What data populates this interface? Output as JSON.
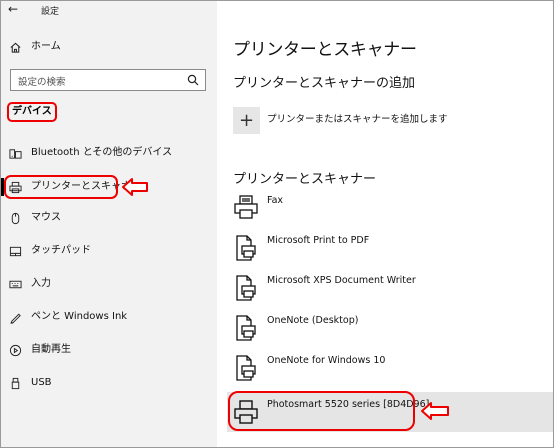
{
  "window": {
    "title": "設定",
    "back_glyph": "←"
  },
  "sidebar": {
    "home_label": "ホーム",
    "search": {
      "placeholder": "設定の検索"
    },
    "category": "デバイス",
    "items": [
      {
        "label": "Bluetooth とその他のデバイス",
        "icon": "keyboard-devices-icon"
      },
      {
        "label": "プリンターとスキャナー",
        "icon": "printer-icon",
        "selected": true
      },
      {
        "label": "マウス",
        "icon": "mouse-icon"
      },
      {
        "label": "タッチパッド",
        "icon": "touchpad-icon"
      },
      {
        "label": "入力",
        "icon": "keyboard-icon"
      },
      {
        "label": "ペンと Windows Ink",
        "icon": "pen-icon"
      },
      {
        "label": "自動再生",
        "icon": "autoplay-icon"
      },
      {
        "label": "USB",
        "icon": "usb-icon"
      }
    ]
  },
  "main": {
    "title": "プリンターとスキャナー",
    "add_section_title": "プリンターとスキャナーの追加",
    "add_button_glyph": "+",
    "add_label": "プリンターまたはスキャナーを追加します",
    "list_section_title": "プリンターとスキャナー",
    "printers": [
      {
        "name": "Fax",
        "icon": "fax-printer-icon"
      },
      {
        "name": "Microsoft Print to PDF",
        "icon": "document-printer-icon"
      },
      {
        "name": "Microsoft XPS Document Writer",
        "icon": "document-printer-icon"
      },
      {
        "name": "OneNote (Desktop)",
        "icon": "document-printer-icon"
      },
      {
        "name": "OneNote for Windows 10",
        "icon": "document-printer-icon"
      },
      {
        "name": "Photosmart 5520 series [8D4D96]",
        "icon": "printer-icon",
        "selected": true
      }
    ]
  },
  "annotation": {
    "color": "#e00000"
  },
  "colors": {
    "sidebar_bg": "#f2f2f2",
    "selected_row_bg": "#e5e5e5"
  }
}
